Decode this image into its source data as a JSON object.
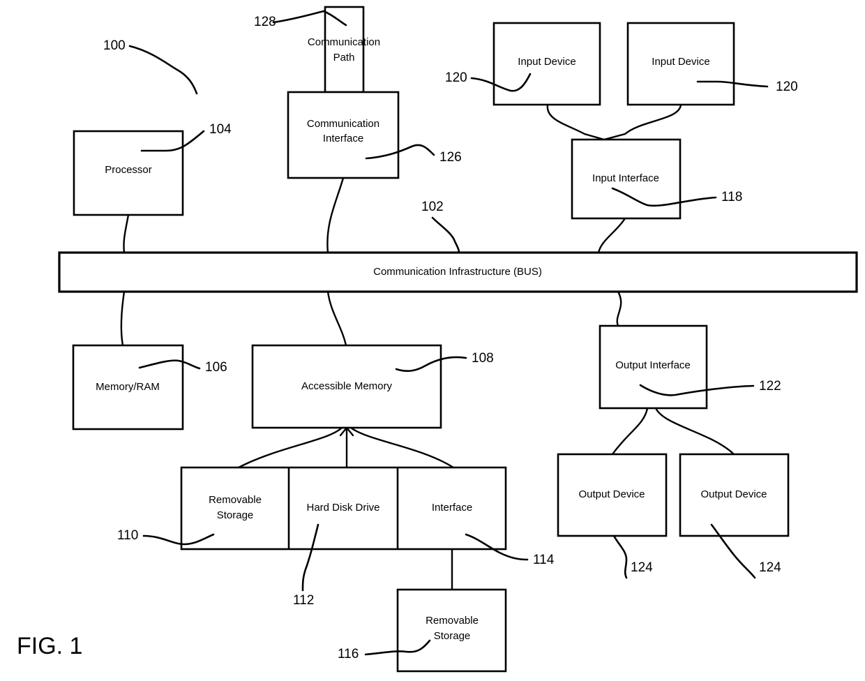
{
  "figure": {
    "caption": "FIG. 1",
    "system_ref": "100"
  },
  "bus": {
    "label": "Communication Infrastructure (BUS)",
    "ref": "102"
  },
  "nodes": {
    "processor": {
      "label": "Processor",
      "ref": "104"
    },
    "memory_ram": {
      "label": "Memory/RAM",
      "ref": "106"
    },
    "accessible_memory": {
      "label": "Accessible Memory",
      "ref": "108"
    },
    "removable_storage_top": {
      "label_line1": "Removable",
      "label_line2": "Storage",
      "ref": "110"
    },
    "hard_disk_drive": {
      "label": "Hard Disk Drive",
      "ref": "112"
    },
    "storage_interface": {
      "label": "Interface",
      "ref": "114"
    },
    "removable_storage_bottom": {
      "label_line1": "Removable",
      "label_line2": "Storage",
      "ref": "116"
    },
    "input_interface": {
      "label": "Input Interface",
      "ref": "118"
    },
    "input_device_1": {
      "label": "Input Device",
      "ref": "120"
    },
    "input_device_2": {
      "label": "Input Device",
      "ref": "120"
    },
    "output_interface": {
      "label": "Output Interface",
      "ref": "122"
    },
    "output_device_1": {
      "label": "Output Device",
      "ref": "124"
    },
    "output_device_2": {
      "label": "Output Device",
      "ref": "124"
    },
    "communication_interface": {
      "label_line1": "Communication",
      "label_line2": "Interface",
      "ref": "126"
    },
    "communication_path": {
      "label_line1": "Communication",
      "label_line2": "Path",
      "ref": "128"
    }
  },
  "colors": {
    "stroke": "#000000",
    "fill": "#ffffff",
    "background": "#ffffff"
  }
}
